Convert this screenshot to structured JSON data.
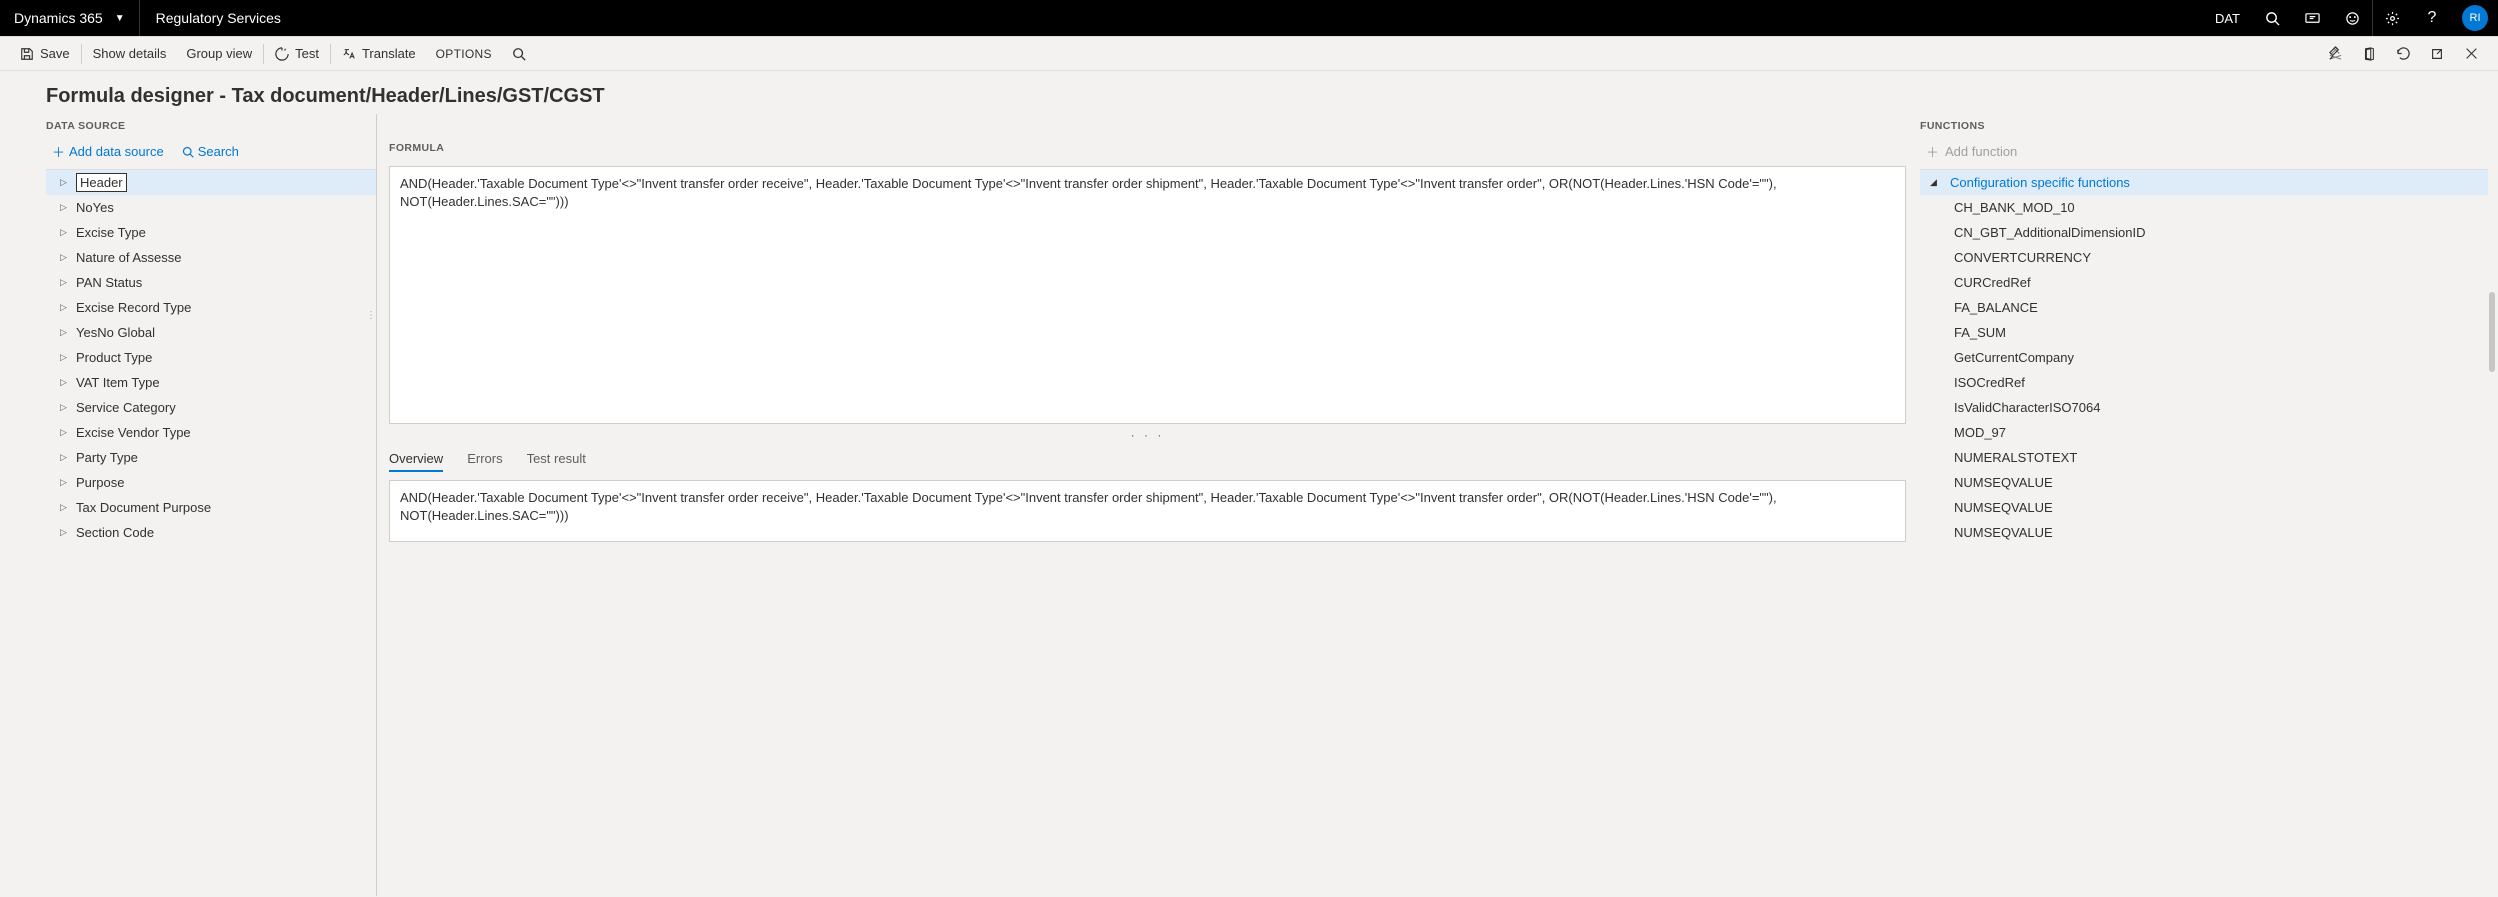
{
  "topbar": {
    "brand": "Dynamics 365",
    "module": "Regulatory Services",
    "company": "DAT",
    "avatar": "RI"
  },
  "actionbar": {
    "save": "Save",
    "show_details": "Show details",
    "group_view": "Group view",
    "test": "Test",
    "translate": "Translate",
    "options": "OPTIONS"
  },
  "page_title": "Formula designer - Tax document/Header/Lines/GST/CGST",
  "data_source": {
    "header": "DATA SOURCE",
    "add_label": "Add data source",
    "search_label": "Search",
    "items": [
      "Header",
      "NoYes",
      "Excise Type",
      "Nature of Assesse",
      "PAN Status",
      "Excise Record Type",
      "YesNo Global",
      "Product Type",
      "VAT Item Type",
      "Service Category",
      "Excise Vendor Type",
      "Party Type",
      "Purpose",
      "Tax Document Purpose",
      "Section Code"
    ]
  },
  "formula": {
    "header": "FORMULA",
    "text": "AND(Header.'Taxable Document Type'<>\"Invent transfer order receive\", Header.'Taxable Document Type'<>\"Invent transfer order shipment\", Header.'Taxable Document Type'<>\"Invent transfer order\", OR(NOT(Header.Lines.'HSN Code'=\"\"), NOT(Header.Lines.SAC=\"\")))"
  },
  "tabs": {
    "overview": "Overview",
    "errors": "Errors",
    "test_result": "Test result"
  },
  "overview_text": "AND(Header.'Taxable Document Type'<>\"Invent transfer order receive\", Header.'Taxable Document Type'<>\"Invent transfer order shipment\", Header.'Taxable Document Type'<>\"Invent transfer order\", OR(NOT(Header.Lines.'HSN Code'=\"\"), NOT(Header.Lines.SAC=\"\")))",
  "functions": {
    "header": "FUNCTIONS",
    "add_label": "Add function",
    "group": "Configuration specific functions",
    "items": [
      "CH_BANK_MOD_10",
      "CN_GBT_AdditionalDimensionID",
      "CONVERTCURRENCY",
      "CURCredRef",
      "FA_BALANCE",
      "FA_SUM",
      "GetCurrentCompany",
      "ISOCredRef",
      "IsValidCharacterISO7064",
      "MOD_97",
      "NUMERALSTOTEXT",
      "NUMSEQVALUE",
      "NUMSEQVALUE",
      "NUMSEQVALUE"
    ]
  }
}
